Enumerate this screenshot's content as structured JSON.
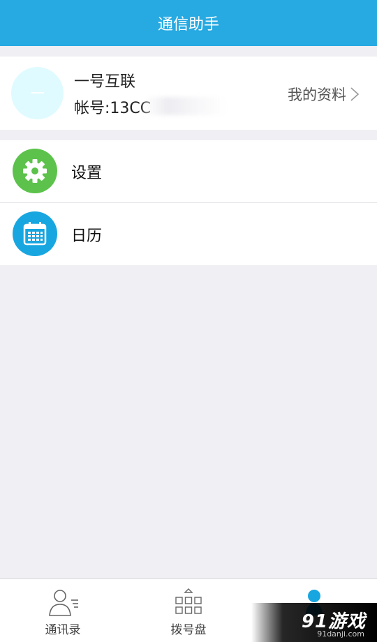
{
  "header": {
    "title": "通信助手"
  },
  "profile": {
    "name": "一号互联",
    "account": "帐号:13CC",
    "link_label": "我的资料"
  },
  "menu": {
    "items": [
      {
        "label": "设置",
        "icon": "gear-icon",
        "color": "#5cc24b"
      },
      {
        "label": "日历",
        "icon": "calendar-icon",
        "color": "#18a6e0"
      }
    ]
  },
  "tabbar": {
    "tabs": [
      {
        "label": "通讯录",
        "icon": "contacts-icon"
      },
      {
        "label": "拨号盘",
        "icon": "dialpad-icon"
      },
      {
        "label": "",
        "icon": "profile-icon",
        "active": true
      }
    ]
  },
  "watermark": {
    "main": "91游戏",
    "sub": "91danji.com"
  },
  "colors": {
    "accent": "#27a9e1",
    "background": "#efeff4",
    "avatar": "#dffbff"
  }
}
